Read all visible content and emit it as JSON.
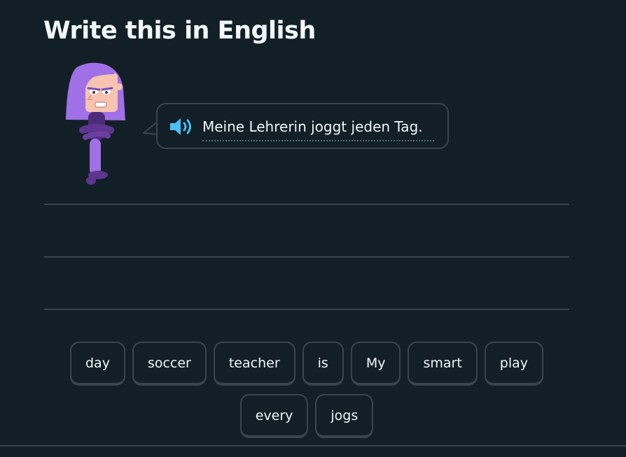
{
  "header": {
    "title": "Write this in English"
  },
  "prompt": {
    "character": "teacher-character",
    "speaker_icon": "speaker-icon",
    "sentence": "Meine Lehrerin joggt jeden Tag."
  },
  "word_bank": {
    "row1": [
      "day",
      "soccer",
      "teacher",
      "is",
      "My",
      "smart",
      "play"
    ],
    "row2": [
      "every",
      "jogs"
    ]
  },
  "colors": {
    "background": "#131f27",
    "border": "#37464f",
    "text": "#f1f7fb",
    "speaker_blue": "#49c0f8",
    "character_purple": "#9069cd"
  }
}
